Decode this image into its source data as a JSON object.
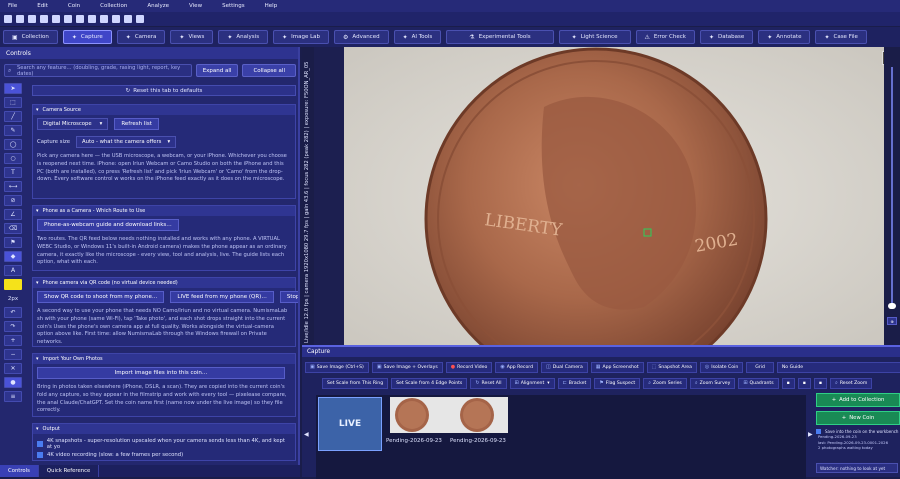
{
  "menu": [
    "File",
    "Edit",
    "Coin",
    "Collection",
    "Analyze",
    "View",
    "Settings",
    "Help"
  ],
  "tabs": [
    {
      "label": "Collection",
      "icon": "folder-icon"
    },
    {
      "label": "Capture",
      "icon": "star-icon",
      "active": true
    },
    {
      "label": "Camera",
      "icon": "star-icon"
    },
    {
      "label": "Views",
      "icon": "star-icon"
    },
    {
      "label": "Analysis",
      "icon": "star-icon"
    },
    {
      "label": "Image Lab",
      "icon": "star-icon"
    },
    {
      "label": "Advanced",
      "icon": "gear-icon"
    },
    {
      "label": "AI Tools",
      "icon": "star-icon"
    },
    {
      "label": "Experimental Tools",
      "icon": "flask-icon"
    },
    {
      "label": "Light Science",
      "icon": "star-icon"
    },
    {
      "label": "Error Check",
      "icon": "warning-icon"
    },
    {
      "label": "Database",
      "icon": "star-icon"
    },
    {
      "label": "Annotate",
      "icon": "star-icon"
    },
    {
      "label": "Case File",
      "icon": "star-icon"
    }
  ],
  "controls": {
    "title": "Controls",
    "search_placeholder": "Search any feature… (doubling, grade, rasing light, report, key dates)",
    "expand_all": "Expand all",
    "collapse_all": "Collapse all",
    "reset_tab": "Reset this tab to defaults",
    "camera_source": {
      "header": "Camera Source",
      "device": "Digital Microscope",
      "refresh": "Refresh list",
      "capture_size_label": "Capture size",
      "capture_size_value": "Auto - what the camera offers",
      "text": "Pick any camera here — the USB microscope, a webcam, or your iPhone. Whichever you choose is reopened next time. iPhone: open Iriun Webcam or Camo Studio on both the iPhone and this PC (both are installed), co press 'Refresh list' and pick 'Iriun Webcam' or 'Camo' from the drop-down. Every software control w works on the iPhone feed exactly as it does on the microscope."
    },
    "phone_camera": {
      "header": "Phone as a Camera - Which Route to Use",
      "button": "Phone-as-webcam guide and download links…",
      "text": "Two routes. The QR feed below needs nothing installed and works with any phone. A VIRTUAL WEBC Studio, or Windows 11's built-in Android camera) makes the phone appear as an ordinary camera, it exactly like the microscope - every view, tool and analysis, live. The guide lists each option, what with each."
    },
    "phone_qr": {
      "header": "Phone camera via QR code (no virtual device needed)",
      "qr_button": "Show QR code to shoot from my phone…",
      "live_button": "LIVE feed from my phone (QR)…",
      "stop_button": "Stop phone",
      "text": "A second way to use your phone that needs NO Camo/Iriun and no virtual camera. NumismaLab sh with your phone (same Wi-Fi), tap 'Take photo', and each shot drops straight into the current coin's Uses the phone's own camera app at full quality. Works alongside the virtual-camera option above like. First time: allow NumismaLab through the Windows firewall on Private networks."
    },
    "import_photos": {
      "header": "Import Your Own Photos",
      "button": "Import image files into this coin…",
      "text": "Bring in photos taken elsewhere (iPhone, DSLR, a scan). They are copied into the current coin's fold any capture, so they appear in the filmstrip and work with every tool — pixelease compare, the anal Claude/ChatGPT. Set the coin name first (name now under the live image) so they file correctly."
    },
    "output": {
      "header": "Output",
      "opt1": "4K snapshots - super-resolution upscaled when your camera sends less than 4K, and kept at yo",
      "opt2": "4K video recording (slow: a few frames per second)"
    }
  },
  "toolstrip": {
    "stroke_size": "2px",
    "text_tool": "T",
    "font_tool": "A"
  },
  "bottom_tabs": [
    "Controls",
    "Quick Reference"
  ],
  "viewer": {
    "status": "Live/Idle 12.0 fps | camera 1920x1080 29.7 fps | gain 43.6 | focus 282 (peak 282) | exposure: F50ON_AR_05"
  },
  "capture": {
    "title": "Capture",
    "row1": [
      "Save Image (Ctrl+S)",
      "Save Image + Overlays",
      "Record Video",
      "App Record",
      "Dual Camera",
      "App Screenshot",
      "Snapshot Area",
      "Isolate Coin",
      "Grid",
      "No Guide"
    ],
    "row2": [
      "Set Scale from This Ring",
      "Set Scale from 4 Edge Points",
      "Reset All",
      "Alignment",
      "Bracket",
      "Flag Suspect",
      "Zoom Series",
      "Zoom Survey",
      "Quadrants",
      "Reset Zoom"
    ],
    "live_label": "LIVE",
    "thumbs": [
      "Pending-2026-09-23",
      "Pending-2026-09-23"
    ],
    "add_to_collection": "Add to Collection",
    "new_coin": "New Coin",
    "save_note": "Save into the coin on the workbench",
    "log": [
      "Pending-2026-09-23",
      "last: Pending-2026-09-23-0001-2026",
      "2 photographs waiting today"
    ],
    "watcher": "Watcher: nothing to look at yet"
  },
  "colors": {
    "accent": "#3f46c8",
    "panel": "#23276e",
    "green": "#198a55"
  }
}
